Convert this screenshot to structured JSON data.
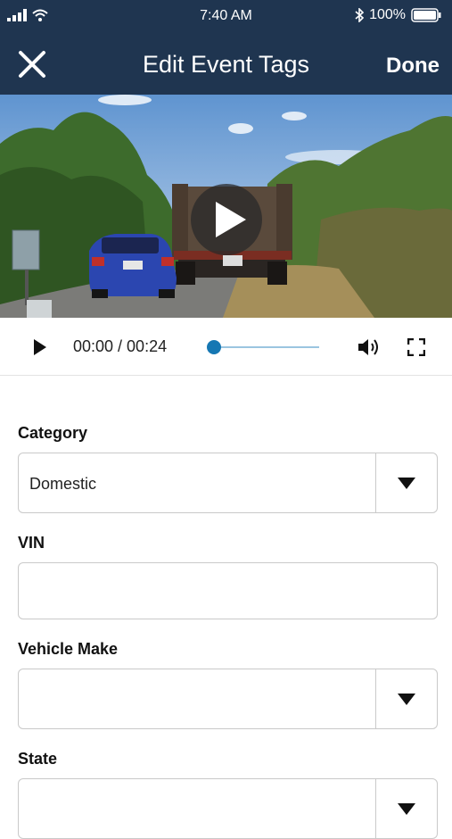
{
  "status_bar": {
    "time": "7:40 AM",
    "battery": "100%"
  },
  "header": {
    "title": "Edit Event Tags",
    "done_label": "Done"
  },
  "player": {
    "time_display": "00:00 / 00:24",
    "progress": 0.0
  },
  "form": {
    "category": {
      "label": "Category",
      "value": "Domestic"
    },
    "vin": {
      "label": "VIN",
      "value": ""
    },
    "vehicle_make": {
      "label": "Vehicle Make",
      "value": ""
    },
    "state": {
      "label": "State",
      "value": ""
    }
  },
  "colors": {
    "header_bg": "#1f3550",
    "accent": "#1677b3"
  }
}
